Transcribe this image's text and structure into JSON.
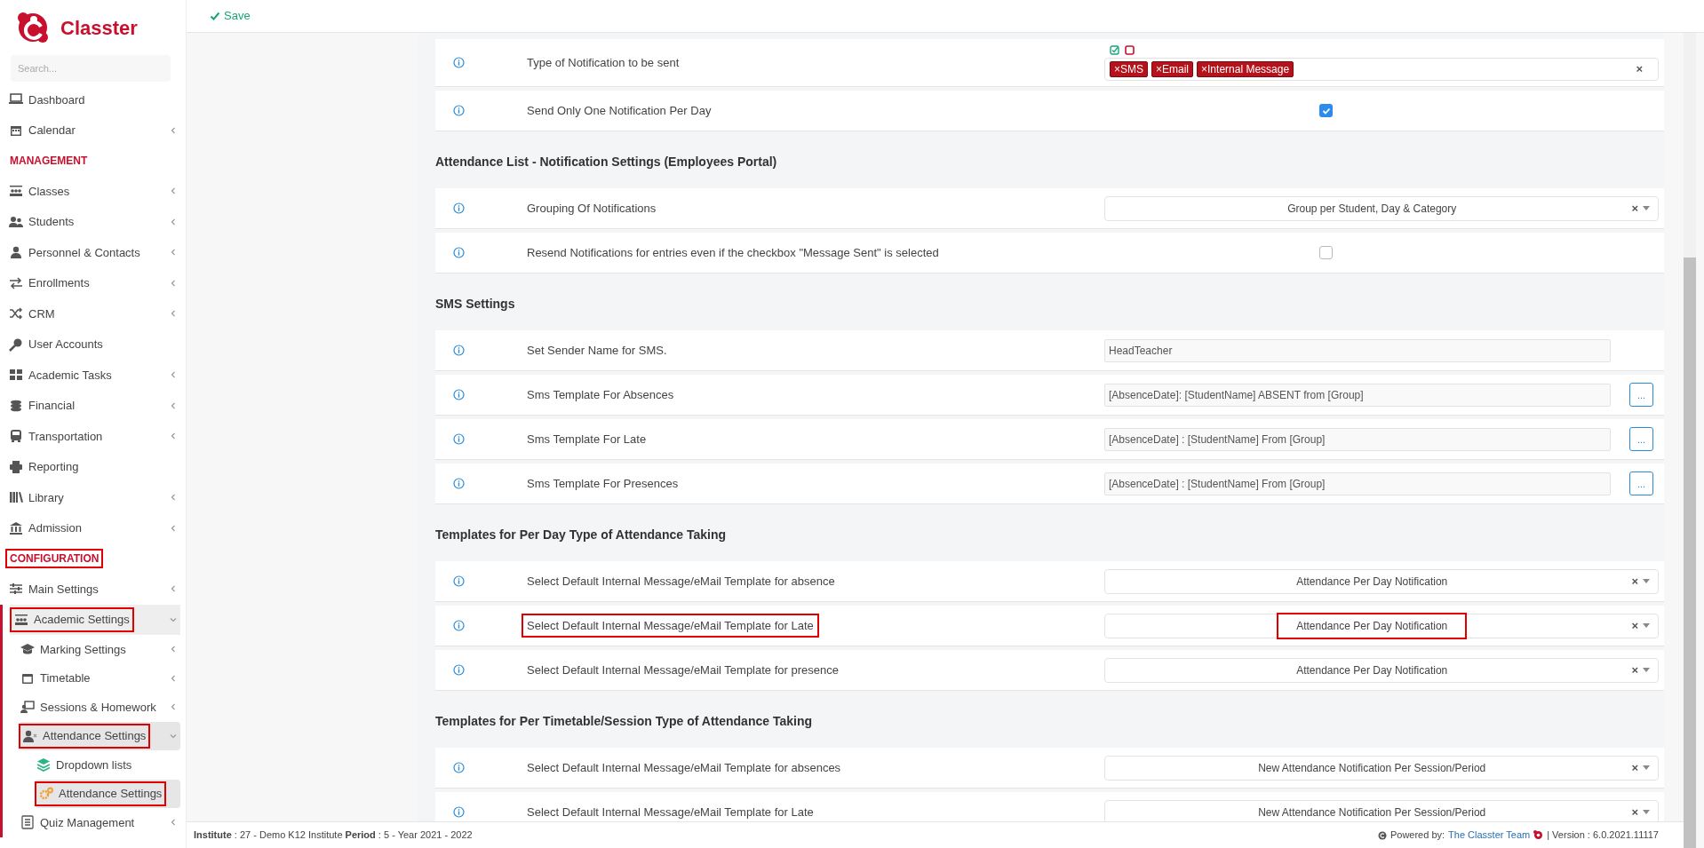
{
  "topbar": {
    "save_label": "Save"
  },
  "sidebar": {
    "logo": "Classter",
    "search_placeholder": "Search...",
    "items": [
      {
        "kind": "item",
        "label": "Dashboard",
        "expandable": false,
        "selected": false,
        "highlighted": false
      },
      {
        "kind": "item",
        "label": "Calendar",
        "expandable": true,
        "expanded": false,
        "selected": false,
        "highlighted": false
      },
      {
        "kind": "section",
        "label": "MANAGEMENT",
        "highlighted": false
      },
      {
        "kind": "item",
        "label": "Classes",
        "expandable": true,
        "expanded": false,
        "selected": false,
        "highlighted": false
      },
      {
        "kind": "item",
        "label": "Students",
        "expandable": true,
        "expanded": false,
        "selected": false,
        "highlighted": false
      },
      {
        "kind": "item",
        "label": "Personnel & Contacts",
        "expandable": true,
        "expanded": false,
        "selected": false,
        "highlighted": false
      },
      {
        "kind": "item",
        "label": "Enrollments",
        "expandable": true,
        "expanded": false,
        "selected": false,
        "highlighted": false
      },
      {
        "kind": "item",
        "label": "CRM",
        "expandable": true,
        "expanded": false,
        "selected": false,
        "highlighted": false
      },
      {
        "kind": "item",
        "label": "User Accounts",
        "expandable": false,
        "selected": false,
        "highlighted": false
      },
      {
        "kind": "item",
        "label": "Academic Tasks",
        "expandable": true,
        "expanded": false,
        "selected": false,
        "highlighted": false
      },
      {
        "kind": "item",
        "label": "Financial",
        "expandable": true,
        "expanded": false,
        "selected": false,
        "highlighted": false
      },
      {
        "kind": "item",
        "label": "Transportation",
        "expandable": true,
        "expanded": false,
        "selected": false,
        "highlighted": false
      },
      {
        "kind": "item",
        "label": "Reporting",
        "expandable": false,
        "selected": false,
        "highlighted": false
      },
      {
        "kind": "item",
        "label": "Library",
        "expandable": true,
        "expanded": false,
        "selected": false,
        "highlighted": false
      },
      {
        "kind": "item",
        "label": "Admission",
        "expandable": true,
        "expanded": false,
        "selected": false,
        "highlighted": false
      },
      {
        "kind": "section",
        "label": "CONFIGURATION",
        "highlighted": true
      },
      {
        "kind": "item",
        "label": "Main Settings",
        "expandable": true,
        "expanded": false,
        "selected": false,
        "highlighted": false
      },
      {
        "kind": "item",
        "label": "Academic Settings",
        "expandable": true,
        "expanded": true,
        "selected": true,
        "highlighted": true,
        "children": [
          {
            "kind": "item",
            "label": "Marking Settings",
            "expandable": true,
            "expanded": false,
            "selected": false,
            "highlighted": false
          },
          {
            "kind": "item",
            "label": "Timetable",
            "expandable": true,
            "expanded": false,
            "selected": false,
            "highlighted": false
          },
          {
            "kind": "item",
            "label": "Sessions & Homework",
            "expandable": true,
            "expanded": false,
            "selected": false,
            "highlighted": false
          },
          {
            "kind": "item",
            "label": "Attendance Settings",
            "expandable": true,
            "expanded": true,
            "selected": true,
            "highlighted": true,
            "children": [
              {
                "kind": "item",
                "label": "Dropdown lists",
                "expandable": false,
                "selected": false,
                "highlighted": false
              },
              {
                "kind": "item",
                "label": "Attendance Settings",
                "expandable": false,
                "selected": true,
                "highlighted": true
              }
            ]
          },
          {
            "kind": "item",
            "label": "Quiz Management",
            "expandable": true,
            "expanded": false,
            "selected": false,
            "highlighted": false
          }
        ]
      }
    ]
  },
  "sections": [
    {
      "rows": [
        {
          "kind": "tags",
          "label": "Type of Notification to be sent",
          "tags": [
            "×SMS",
            "×Email",
            "×Internal Message"
          ],
          "clear": "×",
          "label_highlighted": false
        },
        {
          "kind": "checkbox",
          "label": "Send Only One Notification Per Day",
          "checked": true,
          "label_highlighted": false
        }
      ]
    },
    {
      "title": "Attendance List - Notification Settings (Employees Portal)",
      "rows": [
        {
          "kind": "select",
          "label": "Grouping Of Notifications",
          "value": "Group per Student, Day & Category",
          "clear": "×",
          "label_highlighted": false,
          "value_highlighted": false
        },
        {
          "kind": "checkbox",
          "label": "Resend Notifications for entries even if the checkbox \"Message Sent\" is selected",
          "checked": false,
          "label_highlighted": false
        }
      ]
    },
    {
      "title": "SMS Settings",
      "rows": [
        {
          "kind": "text",
          "label": "Set Sender Name for SMS.",
          "value": "HeadTeacher",
          "label_highlighted": false
        },
        {
          "kind": "text_button",
          "label": "Sms Template For Absences",
          "value": "[AbsenceDate]: [StudentName] ABSENT from [Group]",
          "button": "...",
          "label_highlighted": false
        },
        {
          "kind": "text_button",
          "label": "Sms Template For Late",
          "value": "[AbsenceDate] : [StudentName] From [Group]",
          "button": "...",
          "label_highlighted": false
        },
        {
          "kind": "text_button",
          "label": "Sms Template For Presences",
          "value": "[AbsenceDate] : [StudentName] From [Group]",
          "button": "...",
          "label_highlighted": false
        }
      ]
    },
    {
      "title": "Templates for Per Day Type of Attendance Taking",
      "rows": [
        {
          "kind": "select",
          "label": "Select Default Internal Message/eMail Template for absence",
          "value": "Attendance Per Day Notification",
          "clear": "×",
          "label_highlighted": false,
          "value_highlighted": false
        },
        {
          "kind": "select",
          "label": "Select Default Internal Message/eMail Template for Late",
          "value": "Attendance Per Day Notification",
          "clear": "×",
          "label_highlighted": true,
          "value_highlighted": true
        },
        {
          "kind": "select",
          "label": "Select Default Internal Message/eMail Template for presence",
          "value": "Attendance Per Day Notification",
          "clear": "×",
          "label_highlighted": false,
          "value_highlighted": false
        }
      ]
    },
    {
      "title": "Templates for Per Timetable/Session Type of Attendance Taking",
      "rows": [
        {
          "kind": "select",
          "label": "Select Default Internal Message/eMail Template for absences",
          "value": "New Attendance Notification Per Session/Period",
          "clear": "×",
          "label_highlighted": false,
          "value_highlighted": false
        },
        {
          "kind": "select",
          "label": "Select Default Internal Message/eMail Template for Late",
          "value": "New Attendance Notification Per Session/Period",
          "clear": "×",
          "label_highlighted": false,
          "value_highlighted": false
        }
      ]
    }
  ],
  "footer": {
    "info": "**Institute** : 27 - Demo K12 Institute **Period** : 5 - Year 2021 - 2022",
    "powered_by": "Powered by:",
    "team_link": "The Classter Team",
    "version": "| Version : 6.0.2021.11117"
  }
}
